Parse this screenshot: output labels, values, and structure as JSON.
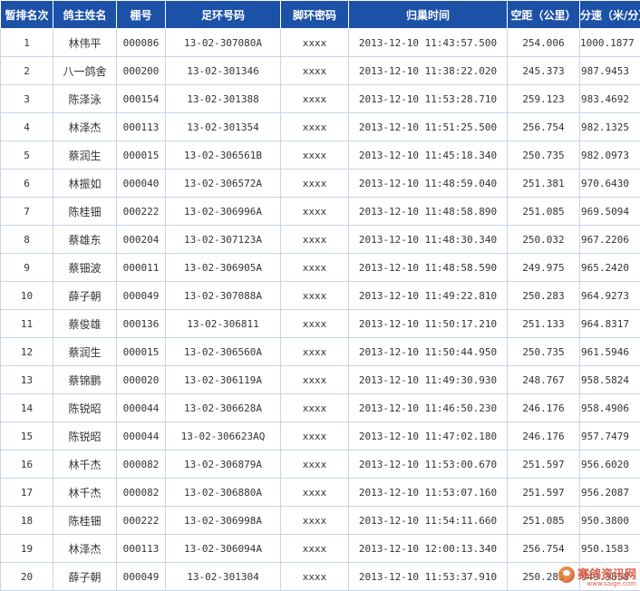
{
  "headers": {
    "rank": "暂排名次",
    "owner": "鸽主姓名",
    "loft": "棚号",
    "ring": "足环号码",
    "code": "脚环密码",
    "time": "归巢时间",
    "distance": "空距（公里）",
    "speed": "分速（米/分）"
  },
  "rows": [
    {
      "rank": "1",
      "owner": "林伟平",
      "loft": "000086",
      "ring": "13-02-307080A",
      "code": "xxxx",
      "time": "2013-12-10 11:43:57.500",
      "distance": "254.006",
      "speed": "1000.1877"
    },
    {
      "rank": "2",
      "owner": "八一鸽舍",
      "loft": "000200",
      "ring": "13-02-301346",
      "code": "xxxx",
      "time": "2013-12-10 11:38:22.020",
      "distance": "245.373",
      "speed": "987.9453"
    },
    {
      "rank": "3",
      "owner": "陈泽泳",
      "loft": "000154",
      "ring": "13-02-301388",
      "code": "xxxx",
      "time": "2013-12-10 11:53:28.710",
      "distance": "259.123",
      "speed": "983.4692"
    },
    {
      "rank": "4",
      "owner": "林泽杰",
      "loft": "000113",
      "ring": "13-02-301354",
      "code": "xxxx",
      "time": "2013-12-10 11:51:25.500",
      "distance": "256.754",
      "speed": "982.1325"
    },
    {
      "rank": "5",
      "owner": "蔡润生",
      "loft": "000015",
      "ring": "13-02-306561B",
      "code": "xxxx",
      "time": "2013-12-10 11:45:18.340",
      "distance": "250.735",
      "speed": "982.0973"
    },
    {
      "rank": "6",
      "owner": "林振如",
      "loft": "000040",
      "ring": "13-02-306572A",
      "code": "xxxx",
      "time": "2013-12-10 11:48:59.040",
      "distance": "251.381",
      "speed": "970.6430"
    },
    {
      "rank": "7",
      "owner": "陈桂钿",
      "loft": "000222",
      "ring": "13-02-306996A",
      "code": "xxxx",
      "time": "2013-12-10 11:48:58.890",
      "distance": "251.085",
      "speed": "969.5094"
    },
    {
      "rank": "8",
      "owner": "蔡雄东",
      "loft": "000204",
      "ring": "13-02-307123A",
      "code": "xxxx",
      "time": "2013-12-10 11:48:30.340",
      "distance": "250.032",
      "speed": "967.2206"
    },
    {
      "rank": "9",
      "owner": "蔡钿波",
      "loft": "000011",
      "ring": "13-02-306905A",
      "code": "xxxx",
      "time": "2013-12-10 11:48:58.590",
      "distance": "249.975",
      "speed": "965.2420"
    },
    {
      "rank": "10",
      "owner": "薛子朝",
      "loft": "000049",
      "ring": "13-02-307088A",
      "code": "xxxx",
      "time": "2013-12-10 11:49:22.810",
      "distance": "250.283",
      "speed": "964.9273"
    },
    {
      "rank": "11",
      "owner": "蔡俊雄",
      "loft": "000136",
      "ring": "13-02-306811",
      "code": "xxxx",
      "time": "2013-12-10 11:50:17.210",
      "distance": "251.133",
      "speed": "964.8317"
    },
    {
      "rank": "12",
      "owner": "蔡润生",
      "loft": "000015",
      "ring": "13-02-306560A",
      "code": "xxxx",
      "time": "2013-12-10 11:50:44.950",
      "distance": "250.735",
      "speed": "961.5946"
    },
    {
      "rank": "13",
      "owner": "蔡锦鹏",
      "loft": "000020",
      "ring": "13-02-306119A",
      "code": "xxxx",
      "time": "2013-12-10 11:49:30.930",
      "distance": "248.767",
      "speed": "958.5824"
    },
    {
      "rank": "14",
      "owner": "陈锐昭",
      "loft": "000044",
      "ring": "13-02-306628A",
      "code": "xxxx",
      "time": "2013-12-10 11:46:50.230",
      "distance": "246.176",
      "speed": "958.4906"
    },
    {
      "rank": "15",
      "owner": "陈锐昭",
      "loft": "000044",
      "ring": "13-02-306623AQ",
      "code": "xxxx",
      "time": "2013-12-10 11:47:02.180",
      "distance": "246.176",
      "speed": "957.7479"
    },
    {
      "rank": "16",
      "owner": "林千杰",
      "loft": "000082",
      "ring": "13-02-306879A",
      "code": "xxxx",
      "time": "2013-12-10 11:53:00.670",
      "distance": "251.597",
      "speed": "956.6020"
    },
    {
      "rank": "17",
      "owner": "林千杰",
      "loft": "000082",
      "ring": "13-02-306880A",
      "code": "xxxx",
      "time": "2013-12-10 11:53:07.160",
      "distance": "251.597",
      "speed": "956.2087"
    },
    {
      "rank": "18",
      "owner": "陈桂钿",
      "loft": "000222",
      "ring": "13-02-306998A",
      "code": "xxxx",
      "time": "2013-12-10 11:54:11.660",
      "distance": "251.085",
      "speed": "950.3800"
    },
    {
      "rank": "19",
      "owner": "林泽杰",
      "loft": "000113",
      "ring": "13-02-306094A",
      "code": "xxxx",
      "time": "2013-12-10 12:00:13.340",
      "distance": "256.754",
      "speed": "950.1583"
    },
    {
      "rank": "20",
      "owner": "薛子朝",
      "loft": "000049",
      "ring": "13-02-301304",
      "code": "xxxx",
      "time": "2013-12-10 11:53:37.910",
      "distance": "250.283",
      "speed": "949.3858"
    }
  ],
  "watermark": {
    "text": "赛鸽资讯网",
    "url": "www.saige.com"
  },
  "colors": {
    "header_bg": "#1c51a8",
    "header_text": "#ffffff",
    "grid_line": "#c9d4e6",
    "watermark": "#d9412b"
  }
}
